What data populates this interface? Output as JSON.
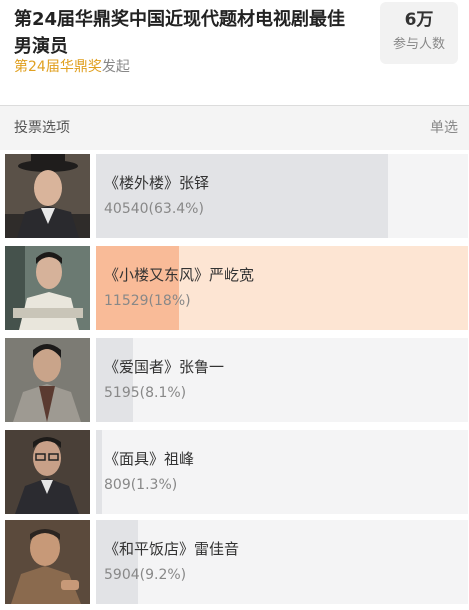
{
  "poll": {
    "title": "第24届华鼎奖中国近现代题材电视剧最佳男演员",
    "sponsor_name": "第24届华鼎奖",
    "sponsor_suffix": "发起",
    "participants": "6万",
    "participants_label": "参与人数"
  },
  "section": {
    "label": "投票选项",
    "mode": "单选"
  },
  "colors": {
    "accent": "#e0a020",
    "bar_fill": "#e2e3e6",
    "selected_bg": "#fde5d3",
    "selected_fill": "#f9bb98"
  },
  "options": [
    {
      "label": "《楼外楼》张铎",
      "votes": "40540(63.4%)",
      "share": 0.786,
      "selected": false,
      "photo": "actor-portrait"
    },
    {
      "label": "《小楼又东风》严屹宽",
      "votes": "11529(18%)",
      "share": 0.224,
      "selected": true,
      "photo": "actor-portrait"
    },
    {
      "label": "《爱国者》张鲁一",
      "votes": "5195(8.1%)",
      "share": 0.1,
      "selected": false,
      "photo": "actor-portrait"
    },
    {
      "label": "《面具》祖峰",
      "votes": "809(1.3%)",
      "share": 0.016,
      "selected": false,
      "photo": "actor-portrait"
    },
    {
      "label": "《和平饭店》雷佳音",
      "votes": "5904(9.2%)",
      "share": 0.114,
      "selected": false,
      "photo": "actor-portrait"
    }
  ]
}
